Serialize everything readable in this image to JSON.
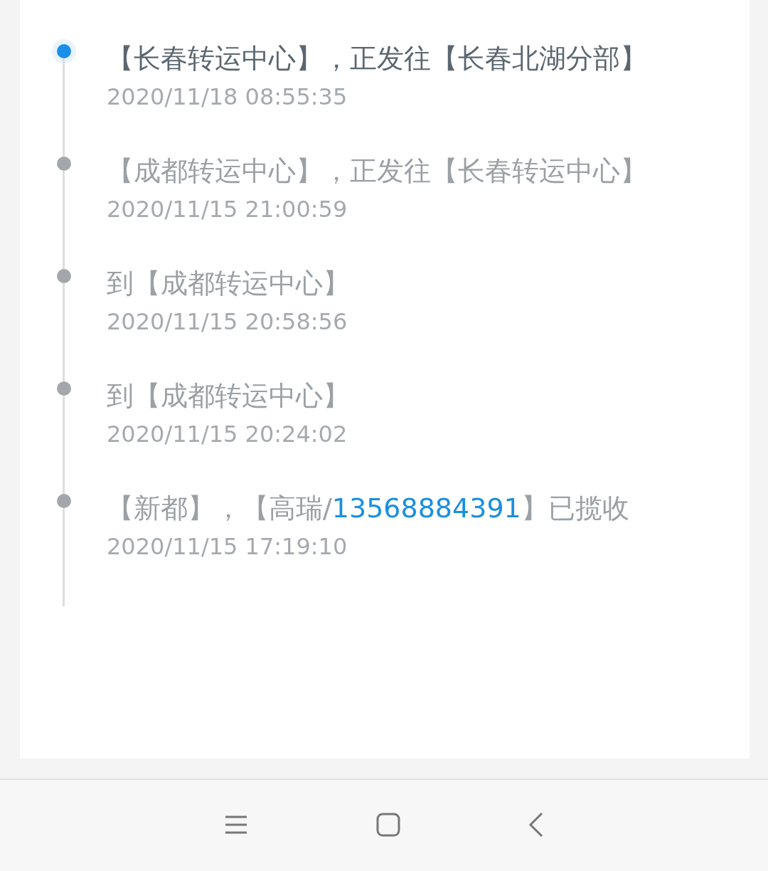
{
  "events": [
    {
      "current": true,
      "segments": [
        {
          "kind": "text",
          "text": "【长春转运中心】，正发往【长春北湖分部】"
        }
      ],
      "time": "2020/11/18 08:55:35"
    },
    {
      "current": false,
      "segments": [
        {
          "kind": "text",
          "text": "【成都转运中心】，正发往【长春转运中心】"
        }
      ],
      "time": "2020/11/15 21:00:59"
    },
    {
      "current": false,
      "segments": [
        {
          "kind": "text",
          "text": "到【成都转运中心】"
        }
      ],
      "time": "2020/11/15 20:58:56"
    },
    {
      "current": false,
      "segments": [
        {
          "kind": "text",
          "text": "到【成都转运中心】"
        }
      ],
      "time": "2020/11/15 20:24:02"
    },
    {
      "current": false,
      "segments": [
        {
          "kind": "text",
          "text": "【新都】，【高瑞/"
        },
        {
          "kind": "phone",
          "text": "13568884391"
        },
        {
          "kind": "text",
          "text": "】已揽收"
        }
      ],
      "time": "2020/11/15 17:19:10"
    }
  ]
}
